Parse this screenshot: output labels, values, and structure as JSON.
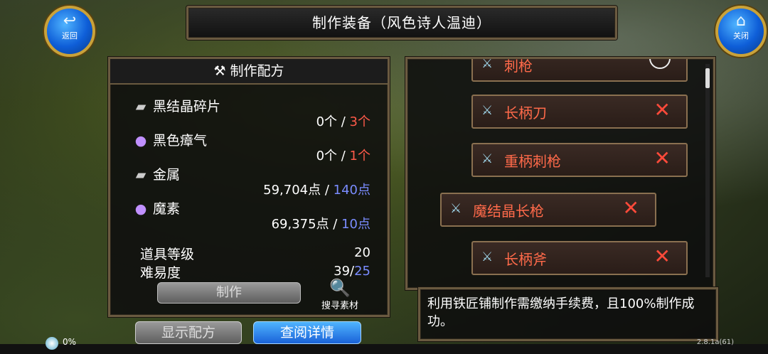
{
  "window": {
    "title": "制作装备（风色诗人温迪）"
  },
  "nav": {
    "back_label": "返回",
    "close_label": "关闭",
    "back_icon": "undo-arrow-icon",
    "close_icon": "home-icon"
  },
  "recipe": {
    "header": "制作配方",
    "header_icon": "anvil-icon",
    "materials": [
      {
        "name": "黑结晶碎片",
        "icon": "ingot-icon",
        "have": "0个",
        "need": "3个",
        "need_color": "#ff5a4a"
      },
      {
        "name": "黑色瘴气",
        "icon": "orb-icon",
        "have": "0个",
        "need": "1个",
        "need_color": "#ff5a4a"
      },
      {
        "name": "金属",
        "icon": "ingot-icon",
        "have": "59,704点",
        "need": "140点",
        "need_color": "#7a8cff"
      },
      {
        "name": "魔素",
        "icon": "orb-icon",
        "have": "69,375点",
        "need": "10点",
        "need_color": "#7a8cff"
      }
    ],
    "separator": " / ",
    "item_level_label": "道具等级",
    "item_level_value": "20",
    "difficulty_label": "难易度",
    "difficulty_value": "39/",
    "difficulty_max": "25",
    "make_label": "制作",
    "search_label": "搜寻素材"
  },
  "buttons": {
    "show_recipe": "显示配方",
    "view_details": "查阅详情"
  },
  "item_list": [
    {
      "label": "刺枪",
      "status": "circle"
    },
    {
      "label": "长柄刀",
      "status": "x"
    },
    {
      "label": "重柄刺枪",
      "status": "x"
    },
    {
      "label": "魔结晶长枪",
      "status": "x",
      "selected": true
    },
    {
      "label": "长柄斧",
      "status": "x"
    }
  ],
  "info_text": "利用铁匠铺制作需缴纳手续费，且100%制作成功。",
  "status": {
    "percent": "0%",
    "version": "2.8.1a(61)"
  }
}
